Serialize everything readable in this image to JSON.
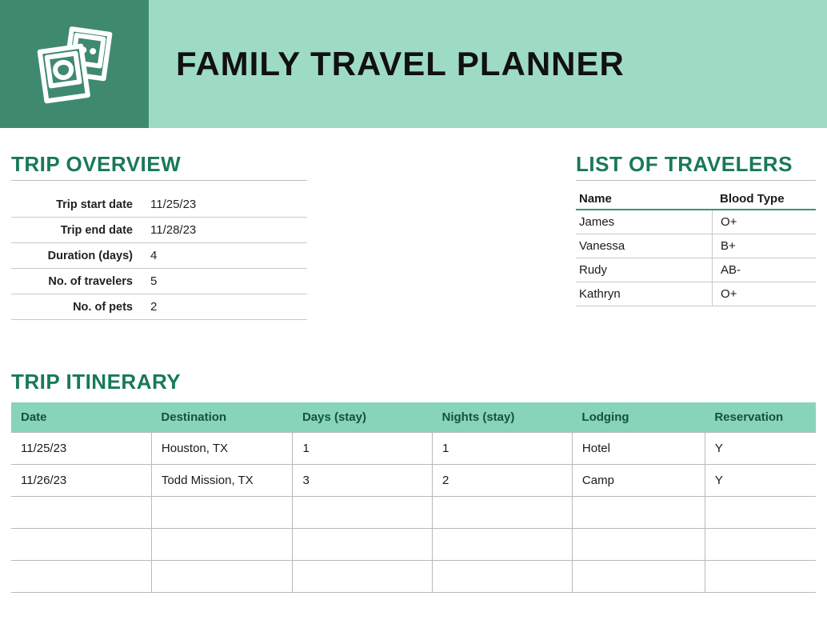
{
  "banner": {
    "title": "FAMILY TRAVEL PLANNER"
  },
  "overview": {
    "title": "TRIP OVERVIEW",
    "rows": [
      {
        "label": "Trip start date",
        "value": "11/25/23"
      },
      {
        "label": "Trip end date",
        "value": "11/28/23"
      },
      {
        "label": "Duration (days)",
        "value": "4"
      },
      {
        "label": "No. of travelers",
        "value": "5"
      },
      {
        "label": "No. of pets",
        "value": "2"
      }
    ]
  },
  "travelers": {
    "title": "LIST OF TRAVELERS",
    "name_header": "Name",
    "blood_header": "Blood Type",
    "rows": [
      {
        "name": "James",
        "blood": "O+"
      },
      {
        "name": "Vanessa",
        "blood": "B+"
      },
      {
        "name": "Rudy",
        "blood": "AB-"
      },
      {
        "name": "Kathryn",
        "blood": "O+"
      }
    ]
  },
  "itinerary": {
    "title": "TRIP ITINERARY",
    "headers": {
      "date": "Date",
      "destination": "Destination",
      "days": "Days (stay)",
      "nights": "Nights (stay)",
      "lodging": "Lodging",
      "reservation": "Reservation"
    },
    "rows": [
      {
        "date": "11/25/23",
        "destination": "Houston, TX",
        "days": "1",
        "nights": "1",
        "lodging": "Hotel",
        "reservation": "Y"
      },
      {
        "date": "11/26/23",
        "destination": "Todd Mission, TX",
        "days": "3",
        "nights": "2",
        "lodging": "Camp",
        "reservation": "Y"
      },
      {
        "date": "",
        "destination": "",
        "days": "",
        "nights": "",
        "lodging": "",
        "reservation": ""
      },
      {
        "date": "",
        "destination": "",
        "days": "",
        "nights": "",
        "lodging": "",
        "reservation": ""
      },
      {
        "date": "",
        "destination": "",
        "days": "",
        "nights": "",
        "lodging": "",
        "reservation": ""
      }
    ]
  }
}
